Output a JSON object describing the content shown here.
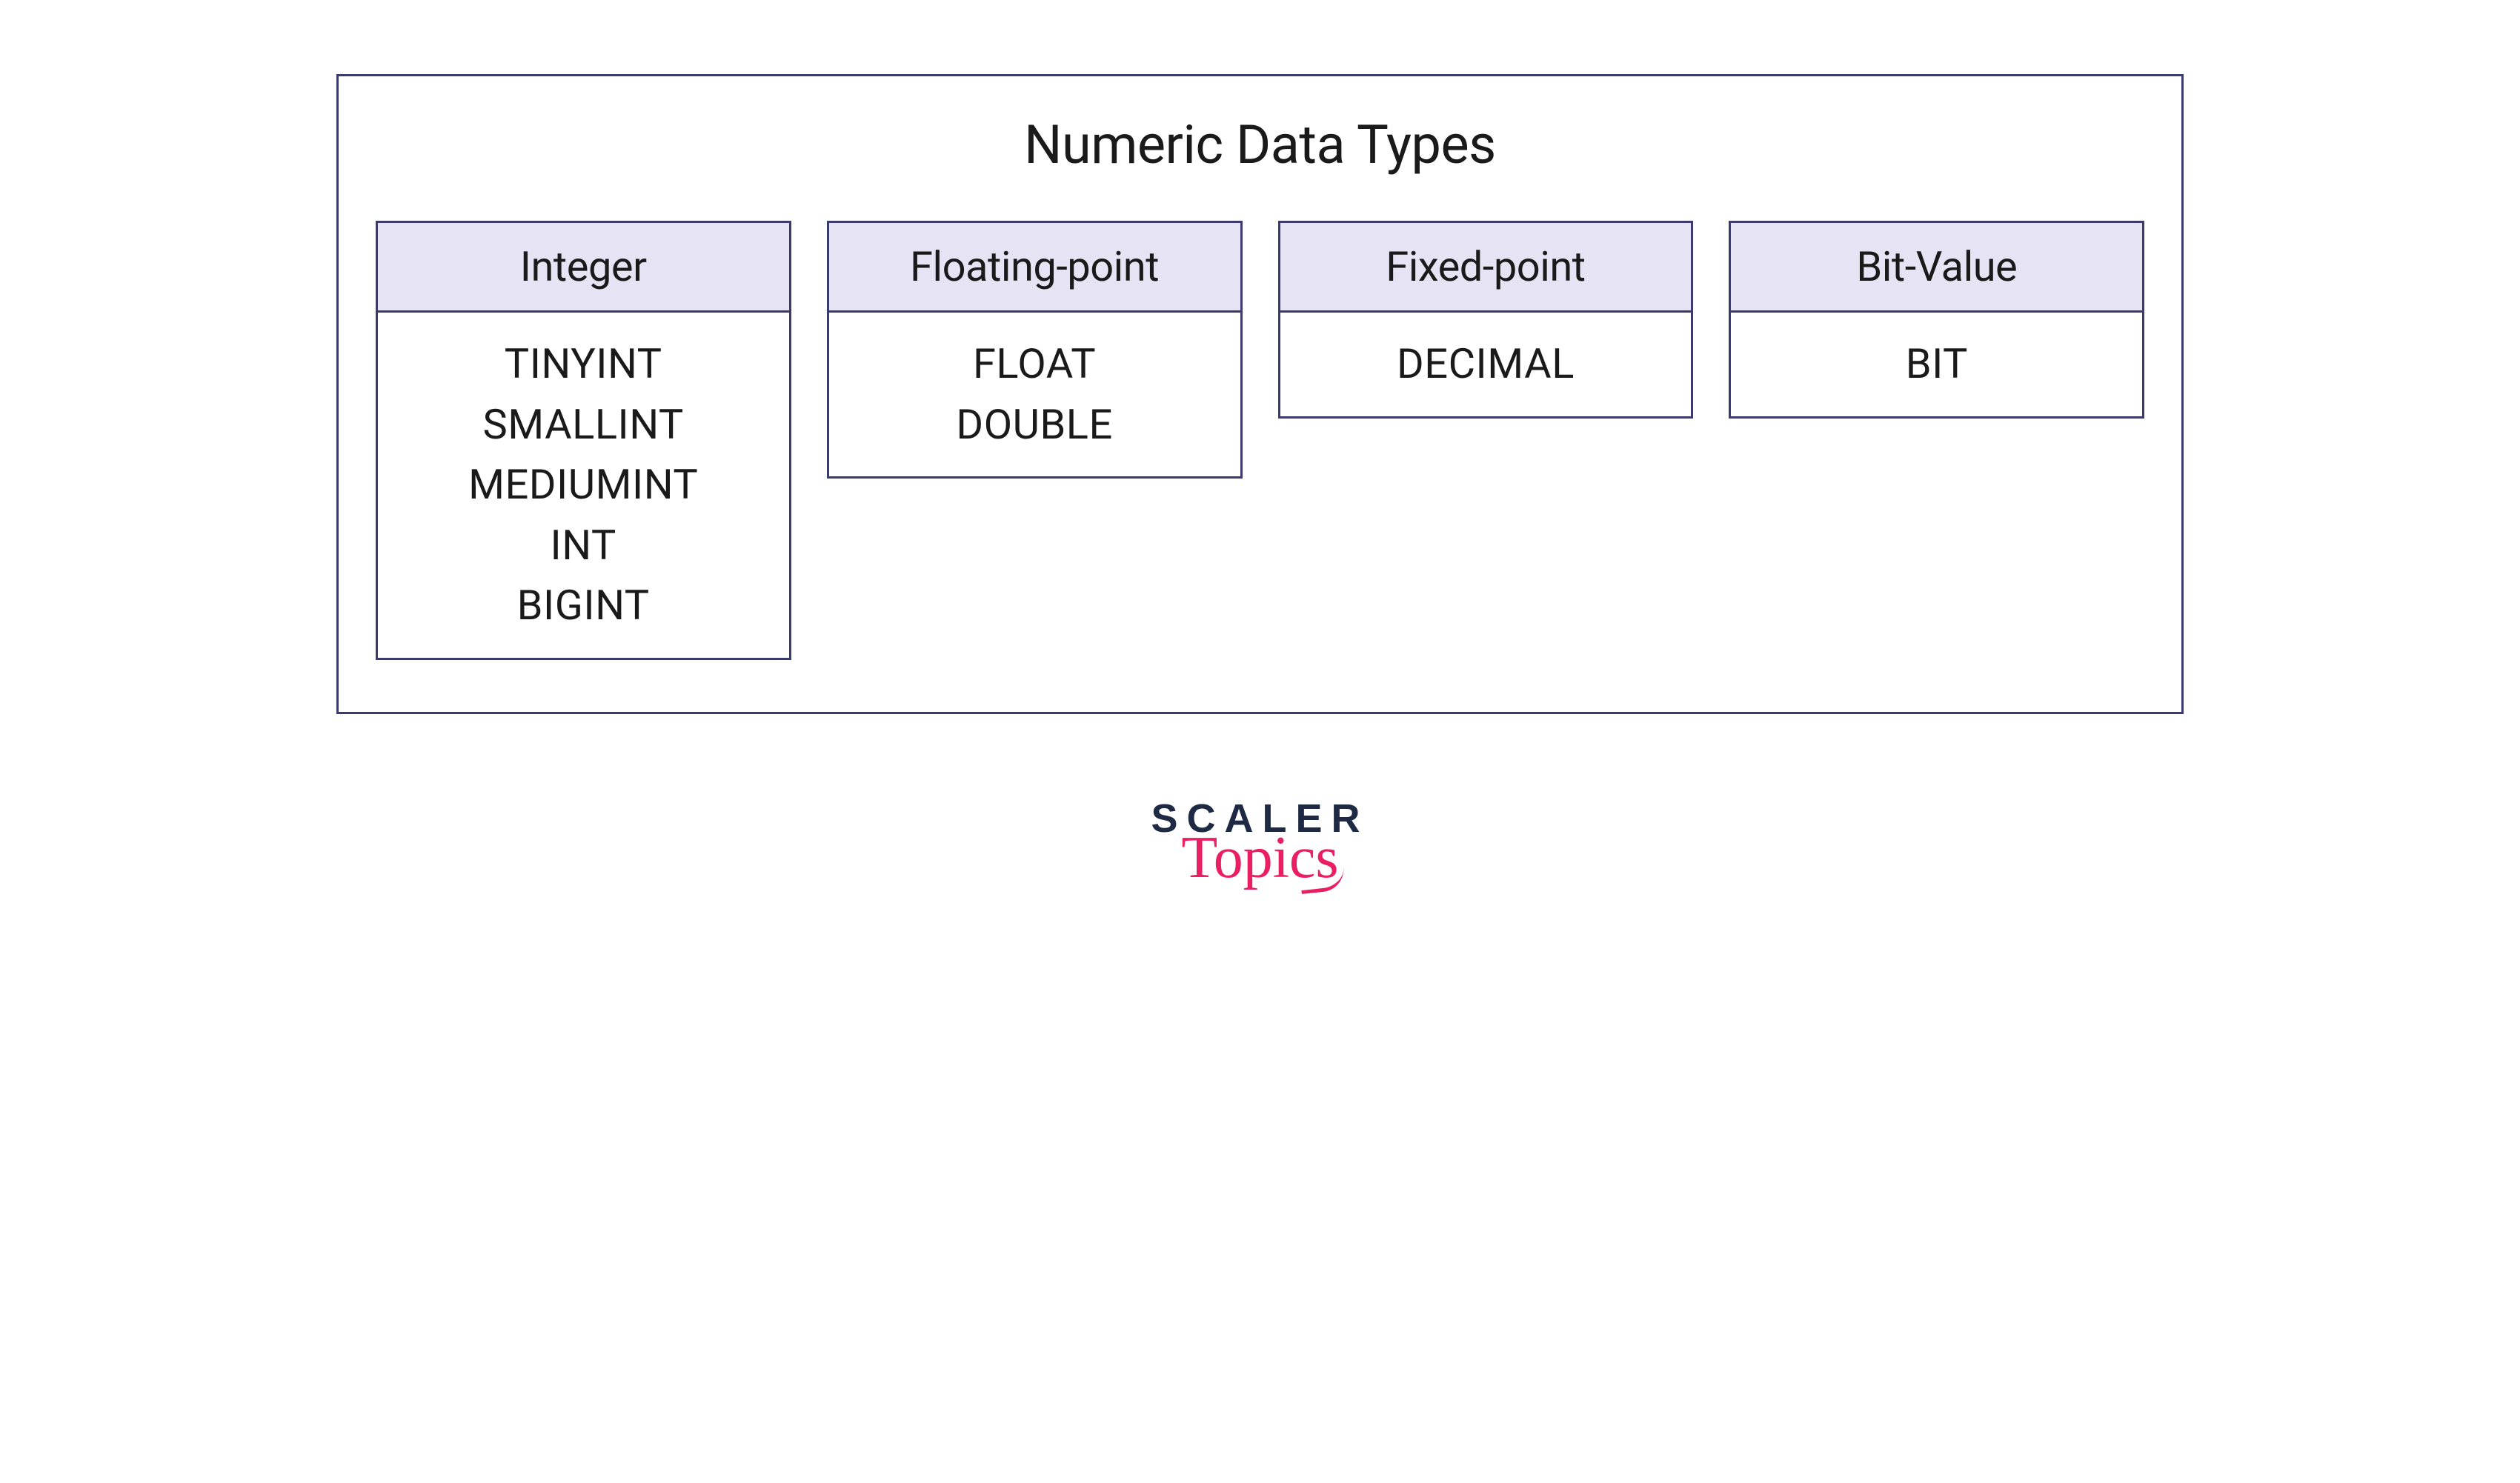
{
  "diagram": {
    "title": "Numeric Data Types",
    "categories": [
      {
        "header": "Integer",
        "types": [
          "TINYINT",
          "SMALLINT",
          "MEDIUMINT",
          "INT",
          "BIGINT"
        ]
      },
      {
        "header": "Floating-point",
        "types": [
          "FLOAT",
          "DOUBLE"
        ]
      },
      {
        "header": "Fixed-point",
        "types": [
          "DECIMAL"
        ]
      },
      {
        "header": "Bit-Value",
        "types": [
          "BIT"
        ]
      }
    ]
  },
  "logo": {
    "line1": "SCALER",
    "line2": "Topics"
  },
  "colors": {
    "border": "#3b3b6d",
    "headerFill": "#e6e3f5",
    "logoDark": "#1e2a44",
    "logoAccent": "#e91e63"
  }
}
